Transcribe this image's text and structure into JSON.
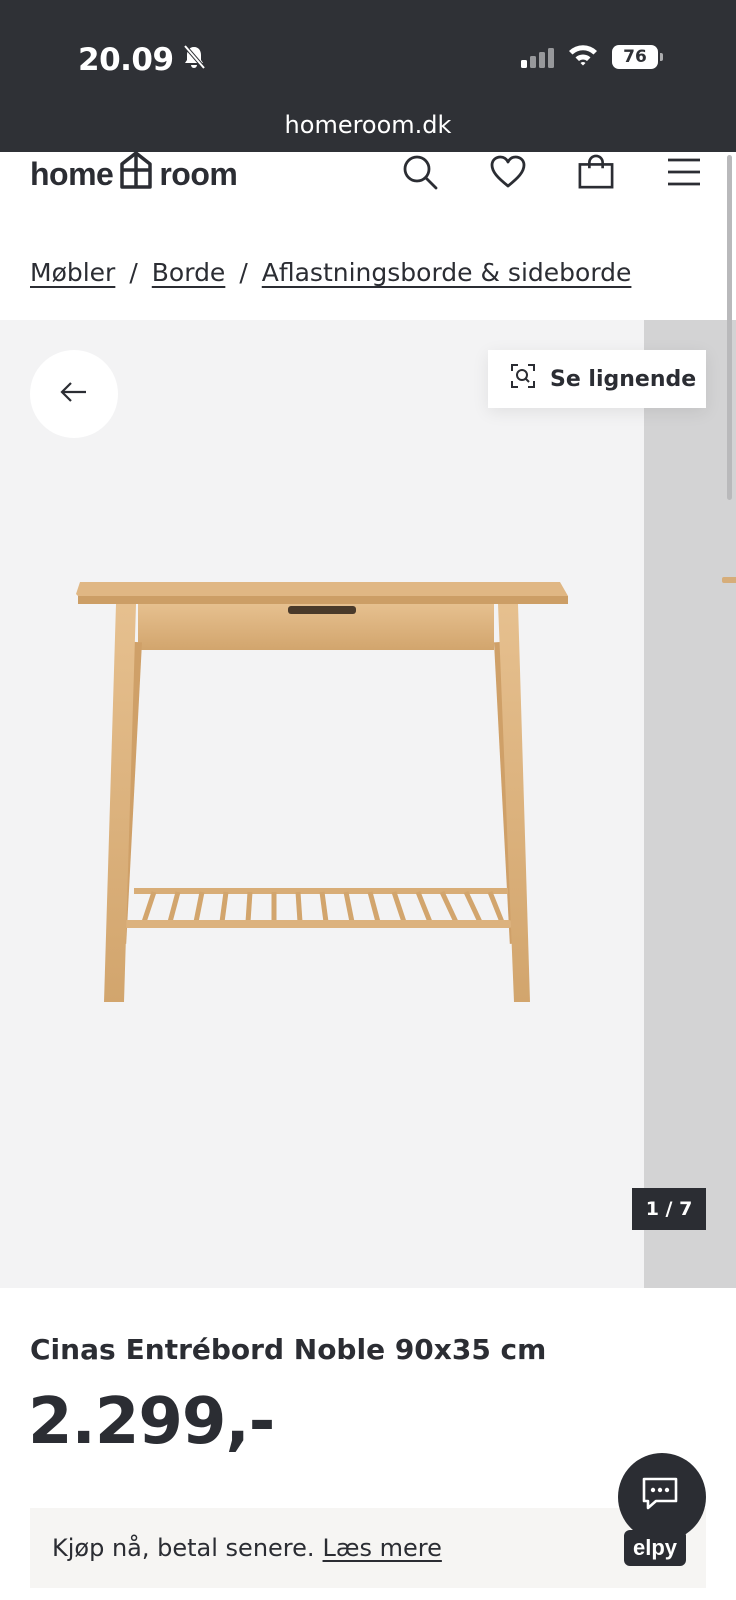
{
  "status_bar": {
    "time": "20.09",
    "battery": "76",
    "url": "homeroom.dk",
    "icons": [
      "bell-slash-icon",
      "signal-icon",
      "wifi-icon",
      "battery-icon"
    ]
  },
  "header": {
    "logo_left": "home",
    "logo_right": "room",
    "icons": [
      "search-icon",
      "heart-icon",
      "bag-icon",
      "menu-icon"
    ]
  },
  "breadcrumb": {
    "items": [
      "Møbler",
      "Borde",
      "Aflastningsborde & sideborde"
    ],
    "separator": "/"
  },
  "gallery": {
    "similar_label": "Se lignende",
    "counter": "1 / 7",
    "back_icon": "arrow-left-icon",
    "similar_icon": "visual-search-icon"
  },
  "product": {
    "brand": "Cinas",
    "name": "Entrébord Noble 90x35 cm",
    "price": "2.299,-"
  },
  "payment": {
    "text": "Kjøp nå, betal senere.",
    "link": "Læs mere"
  },
  "chat": {
    "icon": "chat-icon",
    "badge": "elpy"
  },
  "colors": {
    "status_bar_bg": "#2f3136",
    "text_dark": "#2b2d33",
    "gallery_bg": "#f3f3f4",
    "wood": "#dcb27e"
  }
}
